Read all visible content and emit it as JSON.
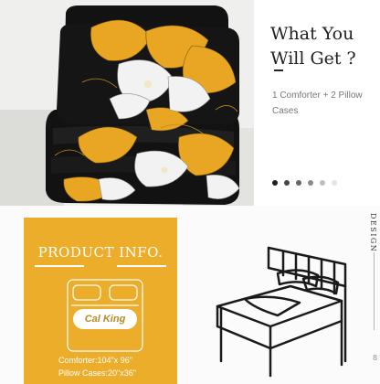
{
  "info": {
    "title_line1": "What You",
    "title_line2": "Will Get ?",
    "subtitle_line1": "1 Comforter + 2 Pillow",
    "subtitle_line2": "Cases"
  },
  "carousel": {
    "dot_colors": [
      "#1f1f1f",
      "#444444",
      "#666666",
      "#8a8a8a",
      "#bdbdbd",
      "#e3e3e3"
    ]
  },
  "product": {
    "heading": "PRODUCT INFO.",
    "size_label": "Cal King",
    "comforter_spec": "Comforter:104\"x 96\"",
    "pillow_spec": "Pillow Cases:20\"x36\""
  },
  "sidebar": {
    "label": "DESIGN",
    "page_number": "8"
  },
  "colors": {
    "accent_gold": "#ecad2a",
    "print_black": "#121212",
    "print_yellow": "#e8a623",
    "print_white": "#f2f2f2"
  },
  "icons": {
    "bedding_diagram": "bedding-set-line-icon",
    "bed_illustration": "bed-line-drawing"
  }
}
